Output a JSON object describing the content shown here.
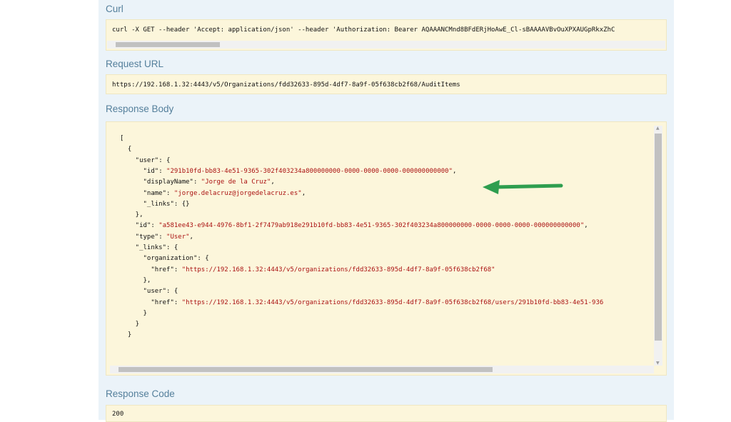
{
  "sections": {
    "curl_heading": "Curl",
    "curl_command": "curl -X GET --header 'Accept: application/json' --header 'Authorization: Bearer AQAAANCMnd8BFdERjHoAwE_Cl-sBAAAAVBvOuXPXAUGpRkxZhC",
    "request_url_heading": "Request URL",
    "request_url": "https://192.168.1.32:4443/v5/Organizations/fdd32633-895d-4df7-8a9f-05f638cb2f68/AuditItems",
    "response_body_heading": "Response Body",
    "response_code_heading": "Response Code",
    "response_code": "200"
  },
  "response_body_lines": [
    [
      "[",
      ""
    ],
    [
      "  {",
      ""
    ],
    [
      "    \"user\"",
      ": {"
    ],
    [
      "      \"id\"",
      ": ",
      "\"291b10fd-bb83-4e51-9365-302f403234a800000000-0000-0000-0000-000000000000\"",
      ","
    ],
    [
      "      \"displayName\"",
      ": ",
      "\"Jorge de la Cruz\"",
      ","
    ],
    [
      "      \"name\"",
      ": ",
      "\"jorge.delacruz@jorgedelacruz.es\"",
      ","
    ],
    [
      "      \"_links\"",
      ": {}"
    ],
    [
      "    },",
      ""
    ],
    [
      "    \"id\"",
      ": ",
      "\"a581ee43-e944-4976-8bf1-2f7479ab918e291b10fd-bb83-4e51-9365-302f403234a800000000-0000-0000-0000-000000000000\"",
      ","
    ],
    [
      "    \"type\"",
      ": ",
      "\"User\"",
      ","
    ],
    [
      "    \"_links\"",
      ": {"
    ],
    [
      "      \"organization\"",
      ": {"
    ],
    [
      "        \"href\"",
      ": ",
      "\"https://192.168.1.32:4443/v5/organizations/fdd32633-895d-4df7-8a9f-05f638cb2f68\"",
      ""
    ],
    [
      "      },",
      ""
    ],
    [
      "      \"user\"",
      ": {"
    ],
    [
      "        \"href\"",
      ": ",
      "\"https://192.168.1.32:4443/v5/organizations/fdd32633-895d-4df7-8a9f-05f638cb2f68/users/291b10fd-bb83-4e51-936",
      ""
    ],
    [
      "      }",
      ""
    ],
    [
      "    }",
      ""
    ],
    [
      "  }",
      ""
    ]
  ],
  "annotation": {
    "arrow_color": "#2e9e4f"
  }
}
